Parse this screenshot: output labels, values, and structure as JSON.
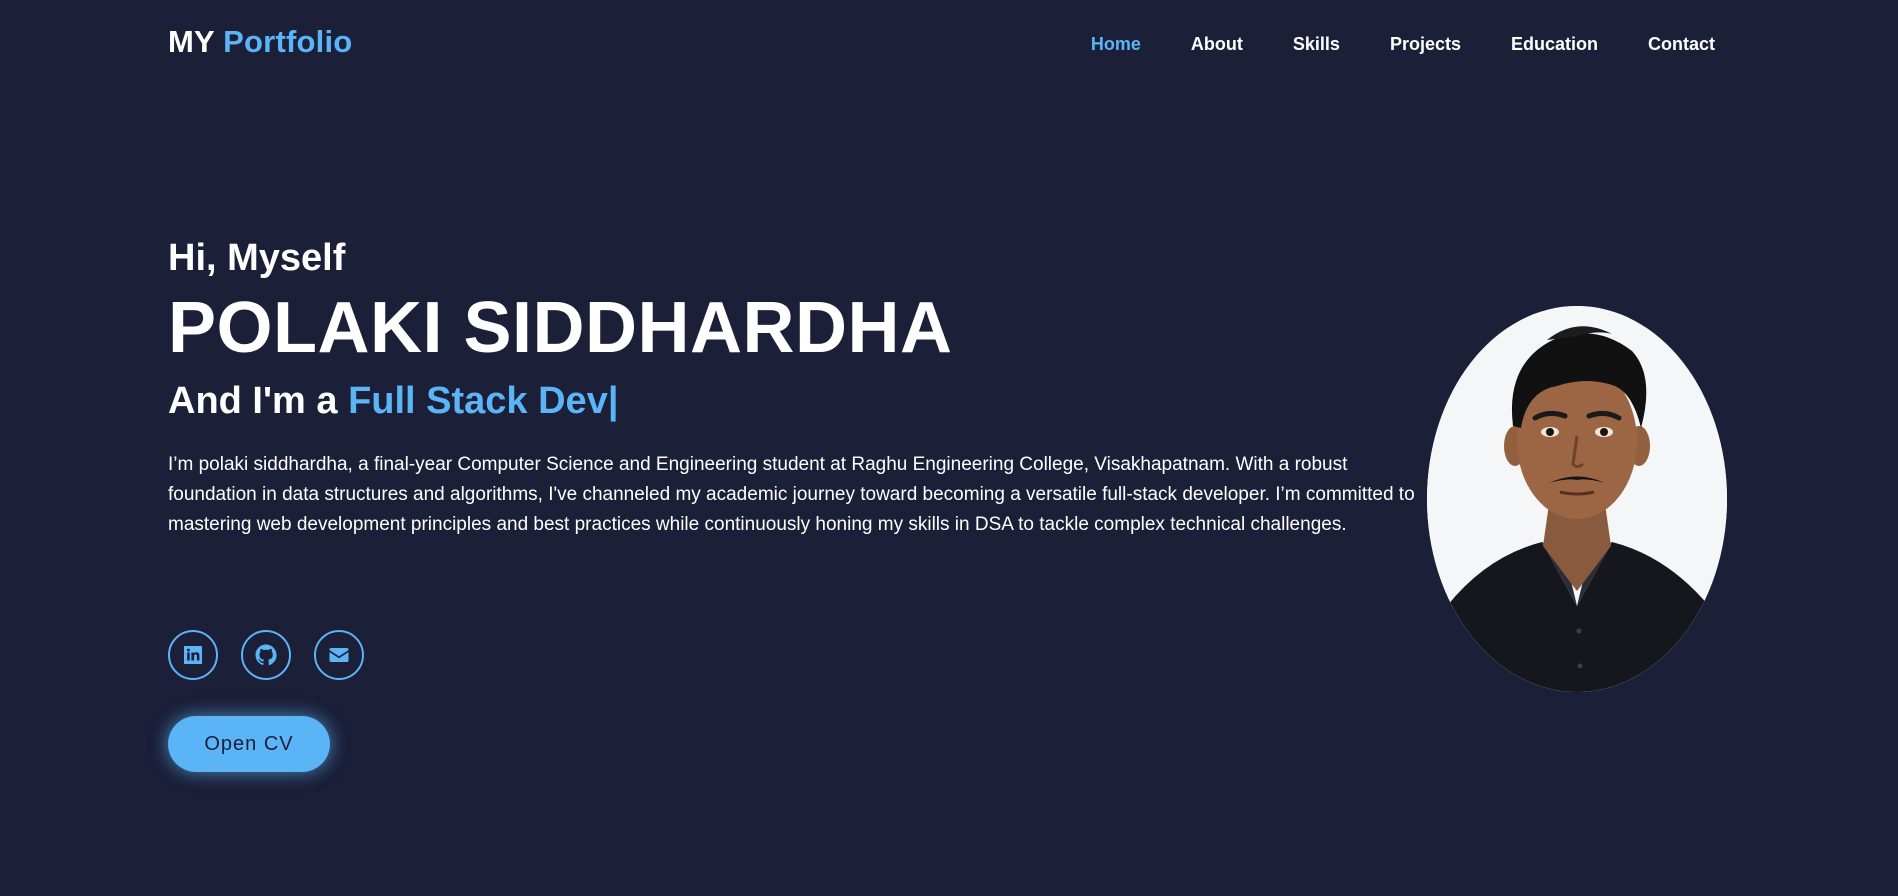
{
  "header": {
    "logo_prefix": "MY",
    "logo_accent": "Portfolio",
    "nav": [
      {
        "label": "Home"
      },
      {
        "label": "About"
      },
      {
        "label": "Skills"
      },
      {
        "label": "Projects"
      },
      {
        "label": "Education"
      },
      {
        "label": "Contact"
      }
    ],
    "active_nav": "Home"
  },
  "hero": {
    "greeting": "Hi, Myself",
    "name": "POLAKI SIDDHARDHA",
    "role_prefix": "And I'm a",
    "role_typed": "Full Stack Dev|",
    "bio": "I’m polaki siddhardha, a final-year Computer Science and Engineering student at Raghu Engineering College, Visakhapatnam. With a robust foundation in data structures and algorithms, I've channeled my academic journey toward becoming a versatile full-stack developer. I’m committed to mastering web development principles and best practices while continuously honing my skills in DSA to tackle complex technical challenges.",
    "socials": [
      {
        "icon": "linkedin-icon"
      },
      {
        "icon": "github-icon"
      },
      {
        "icon": "envelope-icon"
      }
    ],
    "cv_button": "Open CV"
  },
  "colors": {
    "background": "#1b1f38",
    "accent": "#5ab4f6",
    "text": "#ffffff"
  }
}
